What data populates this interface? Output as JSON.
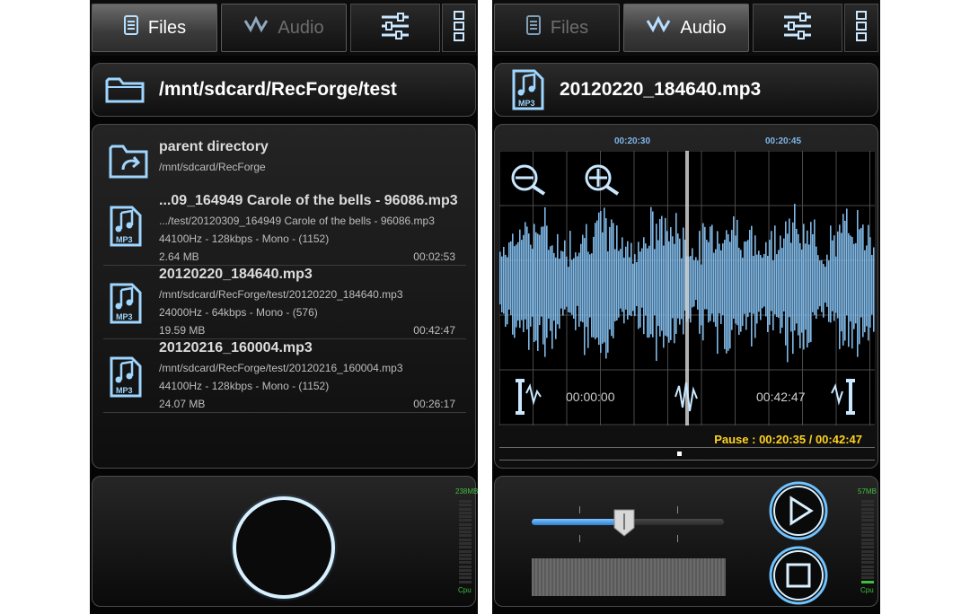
{
  "left": {
    "tabs": [
      {
        "label": "Files",
        "icon": "file-icon",
        "active": true
      },
      {
        "label": "Audio",
        "icon": "waveform-icon",
        "active": false
      }
    ],
    "toolbar": {
      "equalizer_icon": "sliders-icon",
      "menu_icon": "overflow-menu-icon"
    },
    "path": {
      "text": "/mnt/sdcard/RecForge/test",
      "icon": "folder-icon"
    },
    "parent": {
      "title": "parent directory",
      "path": "/mnt/sdcard/RecForge",
      "icon": "folder-up-icon"
    },
    "files": [
      {
        "title": "...09_164949 Carole of the bells - 96086.mp3",
        "path": ".../test/20120309_164949 Carole of the bells - 96086.mp3",
        "info": "44100Hz - 128kbps - Mono - (1152)",
        "size": "2.64 MB",
        "duration": "00:02:53"
      },
      {
        "title": "20120220_184640.mp3",
        "path": "/mnt/sdcard/RecForge/test/20120220_184640.mp3",
        "info": "24000Hz - 64kbps - Mono - (576)",
        "size": "19.59 MB",
        "duration": "00:42:47"
      },
      {
        "title": "20120216_160004.mp3",
        "path": "/mnt/sdcard/RecForge/test/20120216_160004.mp3",
        "info": "44100Hz - 128kbps - Mono - (1152)",
        "size": "24.07 MB",
        "duration": "00:26:17"
      }
    ],
    "meter": {
      "top_label": "238MB",
      "bottom_label": "Cpu",
      "level": 0.0
    }
  },
  "right": {
    "tabs": [
      {
        "label": "Files",
        "icon": "file-icon",
        "active": false
      },
      {
        "label": "Audio",
        "icon": "waveform-icon",
        "active": true
      }
    ],
    "toolbar": {
      "equalizer_icon": "sliders-icon",
      "menu_icon": "overflow-menu-icon"
    },
    "file": {
      "name": "20120220_184640.mp3",
      "icon": "mp3-file-icon"
    },
    "timeline": {
      "mark1": "00:20:30",
      "mark2": "00:20:45"
    },
    "waveform": {
      "start_label": "00:00:00",
      "end_label": "00:42:47",
      "playhead_fraction": 0.5,
      "color": "#7fb8e6"
    },
    "status": "Pause : 00:20:35 / 00:42:47",
    "volume": 0.48,
    "meter": {
      "top_label": "57MB",
      "bottom_label": "Cpu",
      "level": 0.06
    },
    "controls": {
      "play_icon": "play-icon",
      "stop_icon": "stop-icon"
    }
  },
  "colors": {
    "accent": "#6fc3ff",
    "status": "#ffd21f",
    "meter": "#3fbf3f"
  }
}
